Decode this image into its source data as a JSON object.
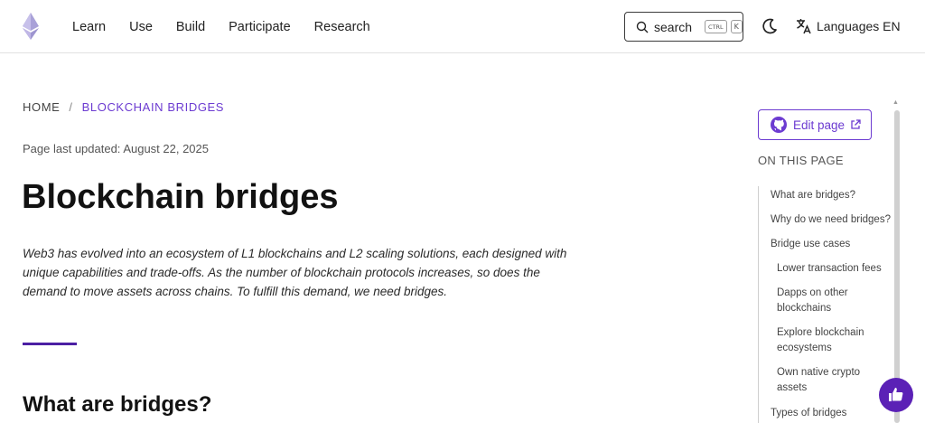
{
  "header": {
    "nav": [
      "Learn",
      "Use",
      "Build",
      "Participate",
      "Research"
    ],
    "search": {
      "label": "search",
      "key1": "CTRL",
      "key2": "K"
    },
    "language": {
      "label": "Languages EN"
    }
  },
  "breadcrumb": {
    "home": "HOME",
    "separator": "/",
    "current": "BLOCKCHAIN BRIDGES"
  },
  "page": {
    "updated": "Page last updated: August 22, 2025",
    "title": "Blockchain bridges",
    "intro": "Web3 has evolved into an ecosystem of L1 blockchains and L2 scaling solutions, each designed with unique capabilities and trade-offs. As the number of blockchain protocols increases, so does the demand to move assets across chains. To fulfill this demand, we need bridges.",
    "section_title": "What are bridges?"
  },
  "sidebar": {
    "edit_label": "Edit page",
    "on_this_page": "ON THIS PAGE",
    "toc": [
      "What are bridges?",
      "Why do we need bridges?",
      "Bridge use cases",
      "Lower transaction fees",
      "Dapps on other blockchains",
      "Explore blockchain ecosystems",
      "Own native crypto assets",
      "Types of bridges"
    ]
  },
  "colors": {
    "accent": "#6c3bd1",
    "accent_dark": "#5b21b6",
    "divider": "#4b1fa3"
  }
}
